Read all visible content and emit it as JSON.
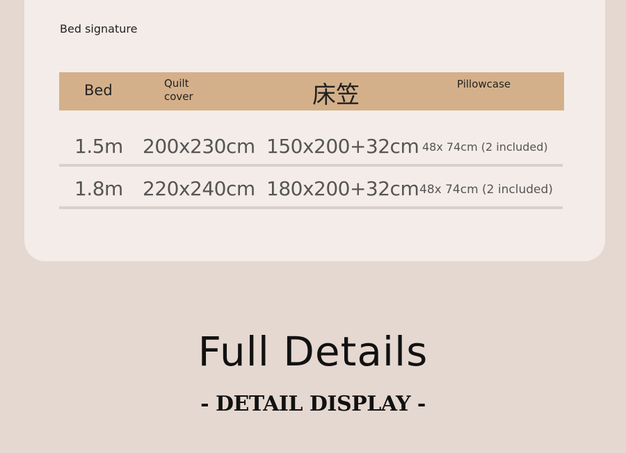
{
  "signature": "Bed signature",
  "table": {
    "headers": {
      "bed": "Bed",
      "quilt_cover": "Quilt cover",
      "fitted_sheet": "床笠",
      "pillowcase": "Pillowcase"
    },
    "rows": [
      {
        "bed": "1.5m",
        "quilt_cover": "200x230cm",
        "fitted_sheet": "150x200+32cm",
        "pillowcase": "48x 74cm (2 included)"
      },
      {
        "bed": "1.8m",
        "quilt_cover": "220x240cm",
        "fitted_sheet": "180x200+32cm",
        "pillowcase": "48x 74cm (2 included)"
      }
    ]
  },
  "details": {
    "title": "Full Details",
    "subtitle": "- DETAIL DISPLAY -"
  },
  "colors": {
    "page_background": "#e5d8d0",
    "card_background": "#f4ece8",
    "header_background": "#d4b08a",
    "row_divider": "#d6d1ce"
  }
}
